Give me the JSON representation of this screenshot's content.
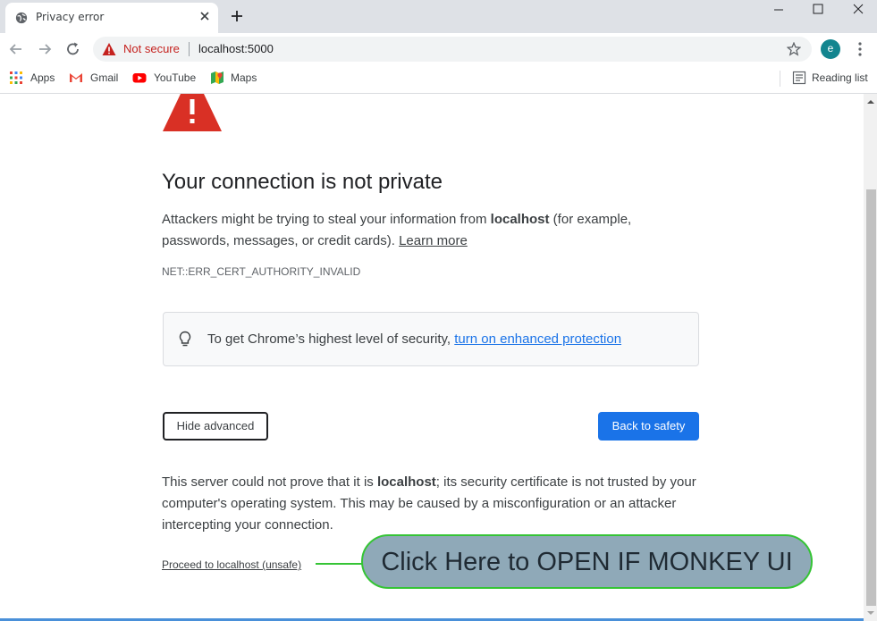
{
  "tab": {
    "title": "Privacy error"
  },
  "omnibox": {
    "security_label": "Not secure",
    "url": "localhost:5000"
  },
  "profile": {
    "initial": "e",
    "color": "#13858f"
  },
  "bookmarks": {
    "items": [
      {
        "label": "Apps",
        "icon": "apps-grid-icon"
      },
      {
        "label": "Gmail",
        "icon": "gmail-icon"
      },
      {
        "label": "YouTube",
        "icon": "youtube-icon"
      },
      {
        "label": "Maps",
        "icon": "maps-icon"
      }
    ],
    "reading_list": "Reading list"
  },
  "page": {
    "heading": "Your connection is not private",
    "para1_prefix": "Attackers might be trying to steal your information from ",
    "para1_host": "localhost",
    "para1_suffix": " (for example, passwords, messages, or credit cards). ",
    "learn_more": "Learn more",
    "error_code": "NET::ERR_CERT_AUTHORITY_INVALID",
    "tip_text": "To get Chrome’s highest level of security, ",
    "tip_link": "turn on enhanced protection",
    "hide_advanced": "Hide advanced",
    "back_to_safety": "Back to safety",
    "para2_prefix": "This server could not prove that it is ",
    "para2_host": "localhost",
    "para2_suffix": "; its security certificate is not trusted by your computer's operating system. This may be caused by a misconfiguration or an attacker intercepting your connection.",
    "proceed_link": "Proceed to localhost (unsafe)"
  },
  "callout": {
    "text": "Click Here to OPEN IF MONKEY UI"
  },
  "colors": {
    "danger": "#d93025",
    "accent": "#1a73e8",
    "callout_border": "#35c435",
    "callout_fill": "#8fa9b8"
  }
}
